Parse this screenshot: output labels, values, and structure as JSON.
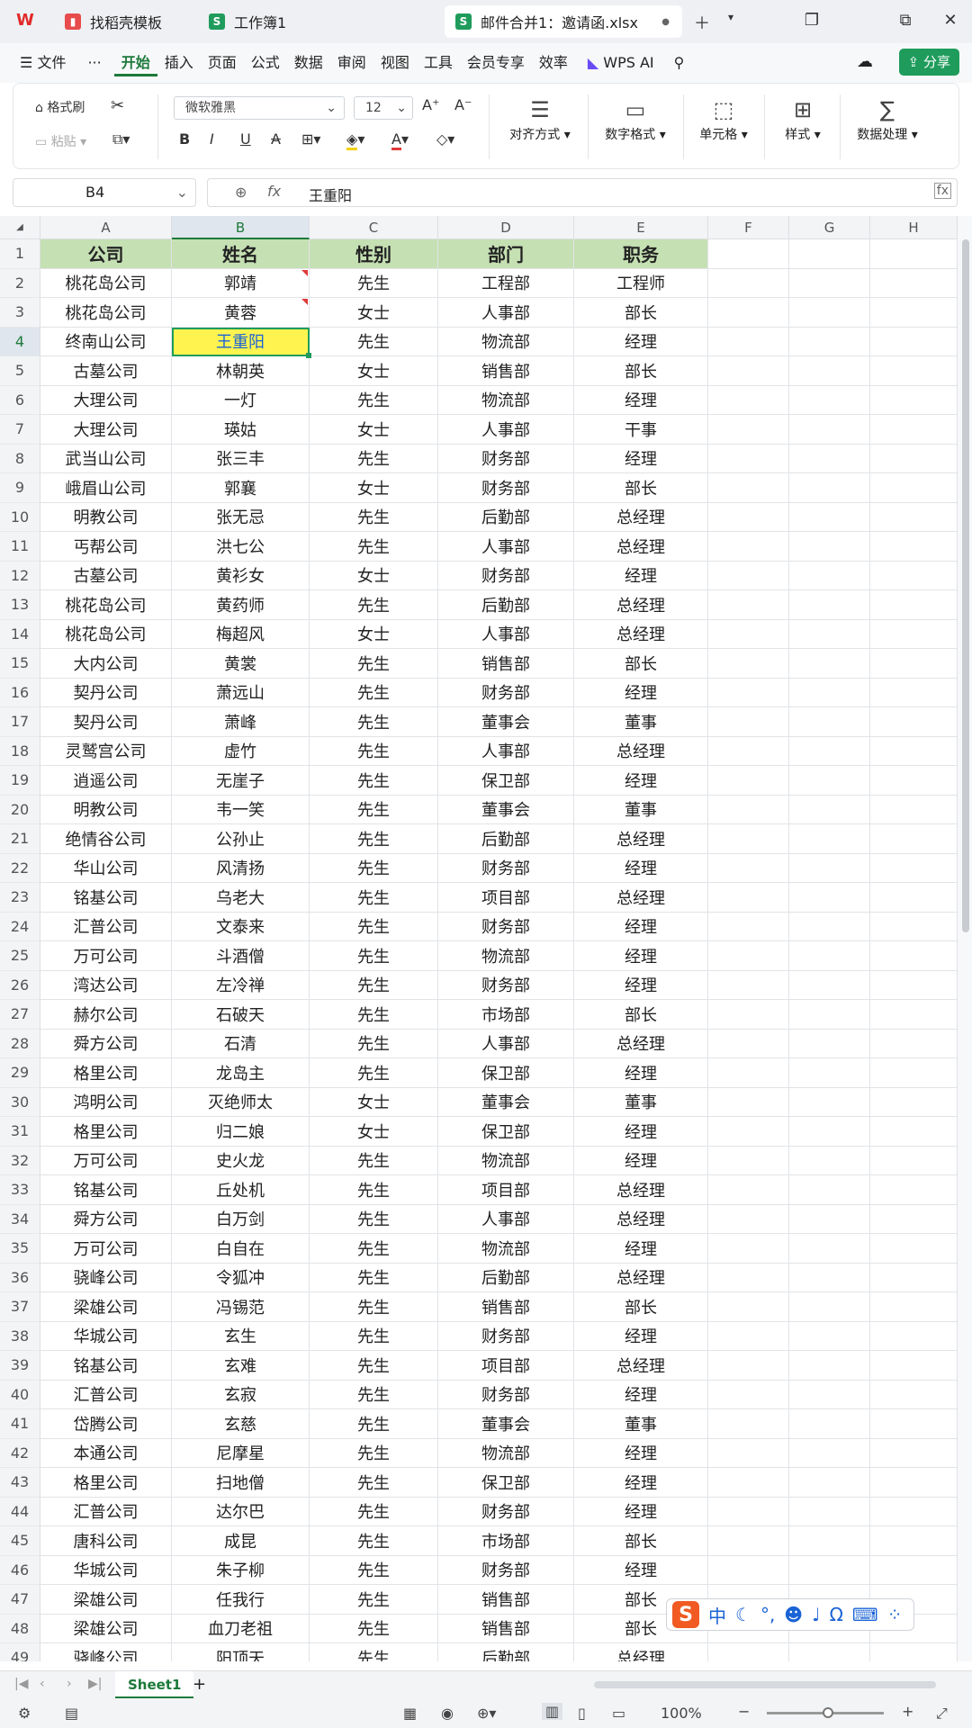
{
  "tabs": [
    {
      "label": "找稻壳模板",
      "icon": "docer-icon",
      "color": "#e84b4b"
    },
    {
      "label": "工作簿1",
      "icon": "sheet-icon",
      "color": "#1f9c5c"
    },
    {
      "label": "邮件合并1：邀请函.xlsx",
      "icon": "sheet-icon",
      "color": "#1f9c5c"
    }
  ],
  "menu": {
    "file": "文件",
    "more": "···",
    "items": [
      "开始",
      "插入",
      "页面",
      "公式",
      "数据",
      "审阅",
      "视图",
      "工具",
      "会员专享",
      "效率"
    ],
    "active": "开始",
    "ai": "WPS AI",
    "share": "分享"
  },
  "ribbon": {
    "format_painter": "格式刷",
    "paste": "粘贴",
    "font": "微软雅黑",
    "font_size": "12",
    "align": "对齐方式",
    "number_format": "数字格式",
    "cell": "单元格",
    "style": "样式",
    "data_process": "数据处理",
    "bold": "B",
    "italic": "I",
    "underline": "U",
    "strike": "A"
  },
  "formula_bar": {
    "cell_ref": "B4",
    "fx": "fx",
    "value": "王重阳"
  },
  "columns": [
    "A",
    "B",
    "C",
    "D",
    "E",
    "F",
    "G",
    "H"
  ],
  "selected_col": "B",
  "header_row": [
    "公司",
    "姓名",
    "性别",
    "部门",
    "职务"
  ],
  "rows": [
    [
      "桃花岛公司",
      "郭靖",
      "先生",
      "工程部",
      "工程师"
    ],
    [
      "桃花岛公司",
      "黄蓉",
      "女士",
      "人事部",
      "部长"
    ],
    [
      "终南山公司",
      "王重阳",
      "先生",
      "物流部",
      "经理"
    ],
    [
      "古墓公司",
      "林朝英",
      "女士",
      "销售部",
      "部长"
    ],
    [
      "大理公司",
      "一灯",
      "先生",
      "物流部",
      "经理"
    ],
    [
      "大理公司",
      "瑛姑",
      "女士",
      "人事部",
      "干事"
    ],
    [
      "武当山公司",
      "张三丰",
      "先生",
      "财务部",
      "经理"
    ],
    [
      "峨眉山公司",
      "郭襄",
      "女士",
      "财务部",
      "部长"
    ],
    [
      "明教公司",
      "张无忌",
      "先生",
      "后勤部",
      "总经理"
    ],
    [
      "丐帮公司",
      "洪七公",
      "先生",
      "人事部",
      "总经理"
    ],
    [
      "古墓公司",
      "黄衫女",
      "女士",
      "财务部",
      "经理"
    ],
    [
      "桃花岛公司",
      "黄药师",
      "先生",
      "后勤部",
      "总经理"
    ],
    [
      "桃花岛公司",
      "梅超风",
      "女士",
      "人事部",
      "总经理"
    ],
    [
      "大内公司",
      "黄裳",
      "先生",
      "销售部",
      "部长"
    ],
    [
      "契丹公司",
      "萧远山",
      "先生",
      "财务部",
      "经理"
    ],
    [
      "契丹公司",
      "萧峰",
      "先生",
      "董事会",
      "董事"
    ],
    [
      "灵鹫宫公司",
      "虚竹",
      "先生",
      "人事部",
      "总经理"
    ],
    [
      "逍遥公司",
      "无崖子",
      "先生",
      "保卫部",
      "经理"
    ],
    [
      "明教公司",
      "韦一笑",
      "先生",
      "董事会",
      "董事"
    ],
    [
      "绝情谷公司",
      "公孙止",
      "先生",
      "后勤部",
      "总经理"
    ],
    [
      "华山公司",
      "风清扬",
      "先生",
      "财务部",
      "经理"
    ],
    [
      "铭基公司",
      "乌老大",
      "先生",
      "项目部",
      "总经理"
    ],
    [
      "汇普公司",
      "文泰来",
      "先生",
      "财务部",
      "经理"
    ],
    [
      "万可公司",
      "斗酒僧",
      "先生",
      "物流部",
      "经理"
    ],
    [
      "湾达公司",
      "左冷禅",
      "先生",
      "财务部",
      "经理"
    ],
    [
      "赫尔公司",
      "石破天",
      "先生",
      "市场部",
      "部长"
    ],
    [
      "舜方公司",
      "石清",
      "先生",
      "人事部",
      "总经理"
    ],
    [
      "格里公司",
      "龙岛主",
      "先生",
      "保卫部",
      "经理"
    ],
    [
      "鸿明公司",
      "灭绝师太",
      "女士",
      "董事会",
      "董事"
    ],
    [
      "格里公司",
      "归二娘",
      "女士",
      "保卫部",
      "经理"
    ],
    [
      "万可公司",
      "史火龙",
      "先生",
      "物流部",
      "经理"
    ],
    [
      "铭基公司",
      "丘处机",
      "先生",
      "项目部",
      "总经理"
    ],
    [
      "舜方公司",
      "白万剑",
      "先生",
      "人事部",
      "总经理"
    ],
    [
      "万可公司",
      "白自在",
      "先生",
      "物流部",
      "经理"
    ],
    [
      "骁峰公司",
      "令狐冲",
      "先生",
      "后勤部",
      "总经理"
    ],
    [
      "梁雄公司",
      "冯锡范",
      "先生",
      "销售部",
      "部长"
    ],
    [
      "华城公司",
      "玄生",
      "先生",
      "财务部",
      "经理"
    ],
    [
      "铭基公司",
      "玄难",
      "先生",
      "项目部",
      "总经理"
    ],
    [
      "汇普公司",
      "玄寂",
      "先生",
      "财务部",
      "经理"
    ],
    [
      "岱腾公司",
      "玄慈",
      "先生",
      "董事会",
      "董事"
    ],
    [
      "本通公司",
      "尼摩星",
      "先生",
      "物流部",
      "经理"
    ],
    [
      "格里公司",
      "扫地僧",
      "先生",
      "保卫部",
      "经理"
    ],
    [
      "汇普公司",
      "达尔巴",
      "先生",
      "财务部",
      "经理"
    ],
    [
      "唐科公司",
      "成昆",
      "先生",
      "市场部",
      "部长"
    ],
    [
      "华城公司",
      "朱子柳",
      "先生",
      "财务部",
      "经理"
    ],
    [
      "梁雄公司",
      "任我行",
      "先生",
      "销售部",
      "部长"
    ],
    [
      "梁雄公司",
      "血刀老祖",
      "先生",
      "销售部",
      "部长"
    ],
    [
      "骁峰公司",
      "阳顶天",
      "先生",
      "后勤部",
      "总经理"
    ]
  ],
  "sheet_tab": "Sheet1",
  "status": {
    "zoom": "100%"
  },
  "ime": {
    "chars": [
      "中",
      "♪"
    ]
  },
  "colors": {
    "accent": "#1f9c5c",
    "header_fill": "#c5e0b3",
    "selection": "#1f9c5c"
  }
}
